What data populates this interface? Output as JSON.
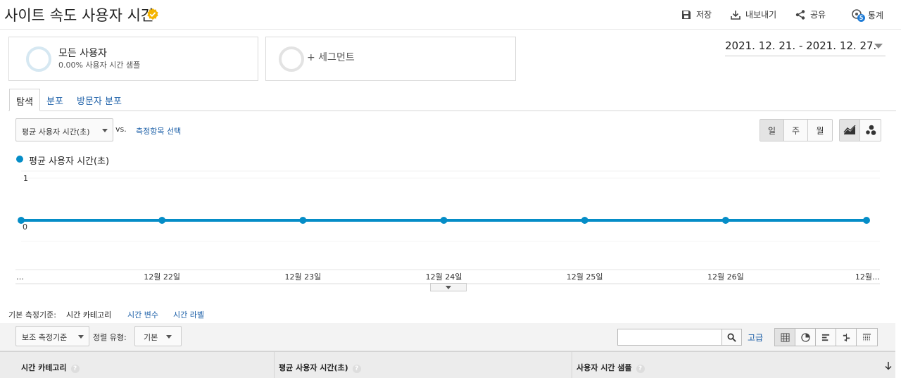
{
  "header": {
    "title": "사이트 속도 사용자 시간",
    "save_label": "저장",
    "export_label": "내보내기",
    "share_label": "공유",
    "insights_label": "통계",
    "insights_badge": "5",
    "accent": "#f4b400"
  },
  "segments": {
    "primary": {
      "name": "모든 사용자",
      "sub": "0.00% 사용자 시간 샘플"
    },
    "add": {
      "label": "+ 세그먼트"
    }
  },
  "date_range": "2021. 12. 21. - 2021. 12. 27.",
  "tabs": [
    {
      "label": "탐색",
      "active": true
    },
    {
      "label": "분포",
      "active": false
    },
    {
      "label": "방문자 분포",
      "active": false
    }
  ],
  "metric": {
    "selected": "평균 사용자 시간(초)",
    "vs": "vs.",
    "choose": "측정항목 선택"
  },
  "granularity": [
    {
      "label": "일",
      "active": true
    },
    {
      "label": "주",
      "active": false
    },
    {
      "label": "월",
      "active": false
    }
  ],
  "chart_data": {
    "type": "line",
    "series": [
      {
        "name": "평균 사용자 시간(초)",
        "color": "#058dc7",
        "values": [
          0,
          0,
          0,
          0,
          0,
          0,
          0
        ]
      }
    ],
    "x_labels": [
      "…",
      "12월 22일",
      "12월 23일",
      "12월 24일",
      "12월 25일",
      "12월 26일",
      "12월…"
    ],
    "y_ticks": [
      "1",
      "0"
    ],
    "ylim": [
      0,
      1
    ]
  },
  "primary_dimension": {
    "label": "기본 측정기준:",
    "items": [
      {
        "label": "시간 카테고리",
        "active": true
      },
      {
        "label": "시간 변수",
        "active": false
      },
      {
        "label": "시간 라벨",
        "active": false
      }
    ]
  },
  "table_toolbar": {
    "secondary_dim": "보조 측정기준",
    "sort_label": "정렬 유형:",
    "sort_value": "기본",
    "search_placeholder": "",
    "advanced": "고급"
  },
  "table": {
    "columns": [
      "시간 카테고리",
      "평균 사용자 시간(초)",
      "사용자 시간 샘플"
    ],
    "help_glyph": "?"
  }
}
